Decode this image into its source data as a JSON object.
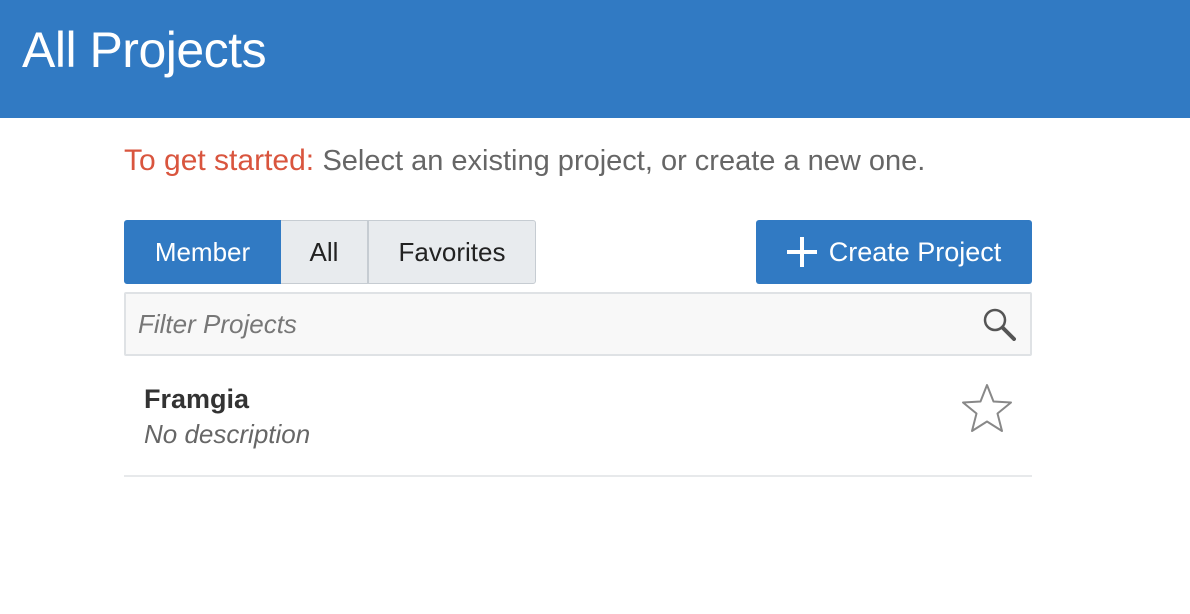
{
  "header": {
    "title": "All Projects"
  },
  "intro": {
    "lead": "To get started:",
    "text": "Select an existing project, or create a new one."
  },
  "filter_tabs": [
    {
      "label": "Member",
      "selected": true
    },
    {
      "label": "All",
      "selected": false
    },
    {
      "label": "Favorites",
      "selected": false
    }
  ],
  "create_button": {
    "label": "Create Project",
    "icon": "plus-icon"
  },
  "search": {
    "placeholder": "Filter Projects",
    "value": "",
    "icon": "search-icon"
  },
  "projects": [
    {
      "name": "Framgia",
      "description": "No description",
      "favorite": false,
      "icon": "star-outline-icon"
    }
  ],
  "colors": {
    "header_bg": "#317ac3",
    "accent": "#317ac3",
    "lead_text": "#d9553e"
  }
}
